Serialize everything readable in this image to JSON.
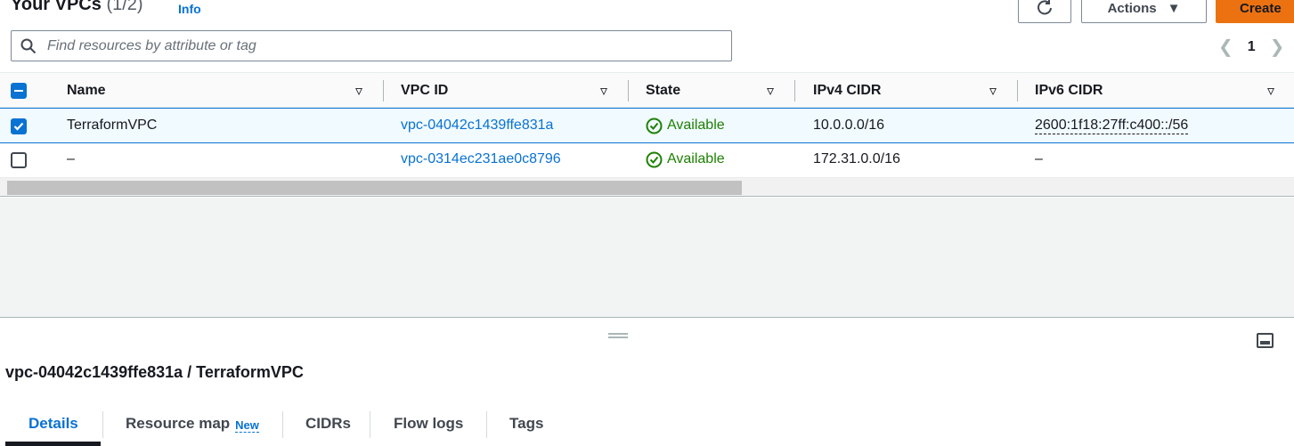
{
  "header": {
    "title": "Your VPCs",
    "count": "(1/2)",
    "info_label": "Info",
    "actions_label": "Actions",
    "create_label": "Create"
  },
  "search": {
    "placeholder": "Find resources by attribute or tag"
  },
  "pagination": {
    "current_page": "1"
  },
  "table": {
    "columns": [
      "Name",
      "VPC ID",
      "State",
      "IPv4 CIDR",
      "IPv6 CIDR"
    ],
    "rows": [
      {
        "selected": true,
        "name": "TerraformVPC",
        "vpc_id": "vpc-04042c1439ffe831a",
        "state": "Available",
        "ipv4_cidr": "10.0.0.0/16",
        "ipv6_cidr": "2600:1f18:27ff:c400::/56"
      },
      {
        "selected": false,
        "name": "–",
        "vpc_id": "vpc-0314ec231ae0c8796",
        "state": "Available",
        "ipv4_cidr": "172.31.0.0/16",
        "ipv6_cidr": "–"
      }
    ]
  },
  "detail": {
    "title": "vpc-04042c1439ffe831a / TerraformVPC",
    "tabs": [
      {
        "label": "Details",
        "active": true
      },
      {
        "label": "Resource map",
        "badge": "New"
      },
      {
        "label": "CIDRs"
      },
      {
        "label": "Flow logs"
      },
      {
        "label": "Tags"
      }
    ]
  },
  "colors": {
    "accent": "#0972d3",
    "create_button": "#ec7211",
    "success": "#1d8102"
  },
  "icons": [
    "refresh-icon",
    "caret-down-icon",
    "search-icon",
    "chevron-left-icon",
    "chevron-right-icon",
    "sort-icon",
    "checkbox-icon",
    "status-check-icon",
    "drag-handle-icon",
    "split-panel-icon"
  ]
}
